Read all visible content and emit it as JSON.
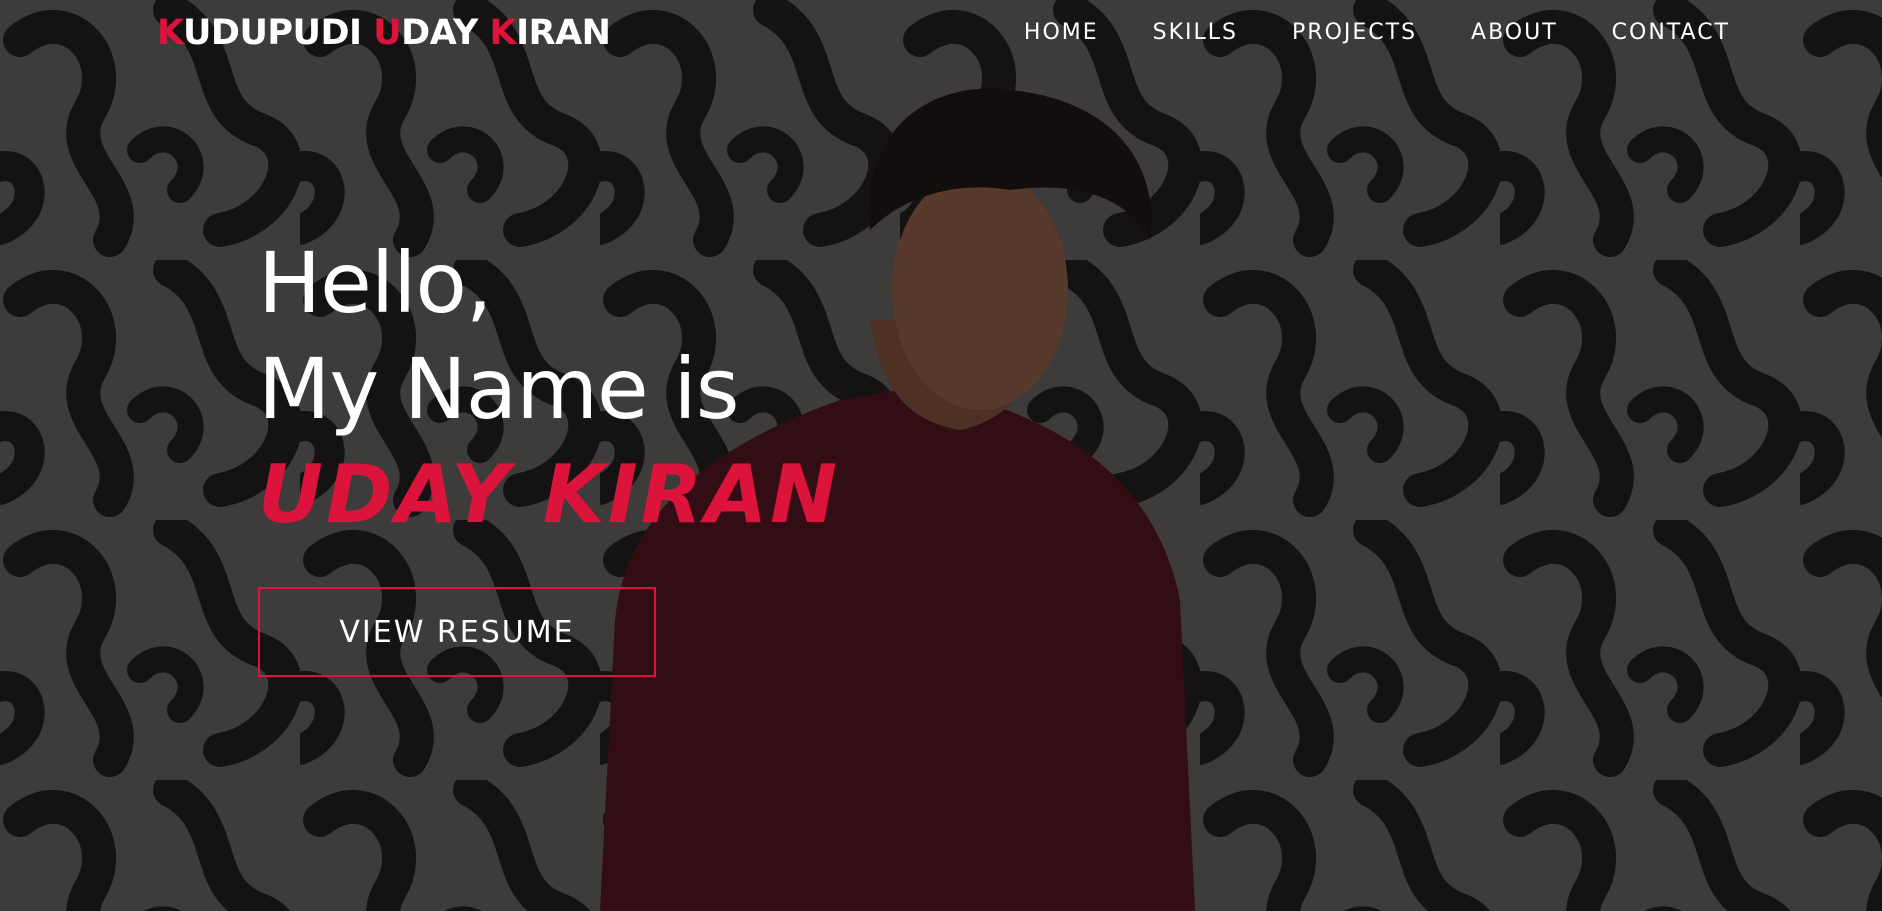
{
  "colors": {
    "accent": "#dc143c",
    "text": "#ffffff",
    "background": "#3d3b3b"
  },
  "brand": {
    "parts": [
      {
        "text": "K",
        "accent": true
      },
      {
        "text": "UDUPUDI ",
        "accent": false
      },
      {
        "text": "U",
        "accent": true
      },
      {
        "text": "DAY ",
        "accent": false
      },
      {
        "text": "K",
        "accent": true
      },
      {
        "text": "IRAN",
        "accent": false
      }
    ]
  },
  "nav": {
    "items": [
      {
        "label": "HOME"
      },
      {
        "label": "SKILLS"
      },
      {
        "label": "PROJECTS"
      },
      {
        "label": "ABOUT"
      },
      {
        "label": "CONTACT"
      }
    ]
  },
  "hero": {
    "line1": "Hello,",
    "line2": "My Name is",
    "name": "UDAY KIRAN",
    "button_label": "VIEW RESUME"
  },
  "background": {
    "image": "portrait-photo-on-patterned-wall"
  }
}
